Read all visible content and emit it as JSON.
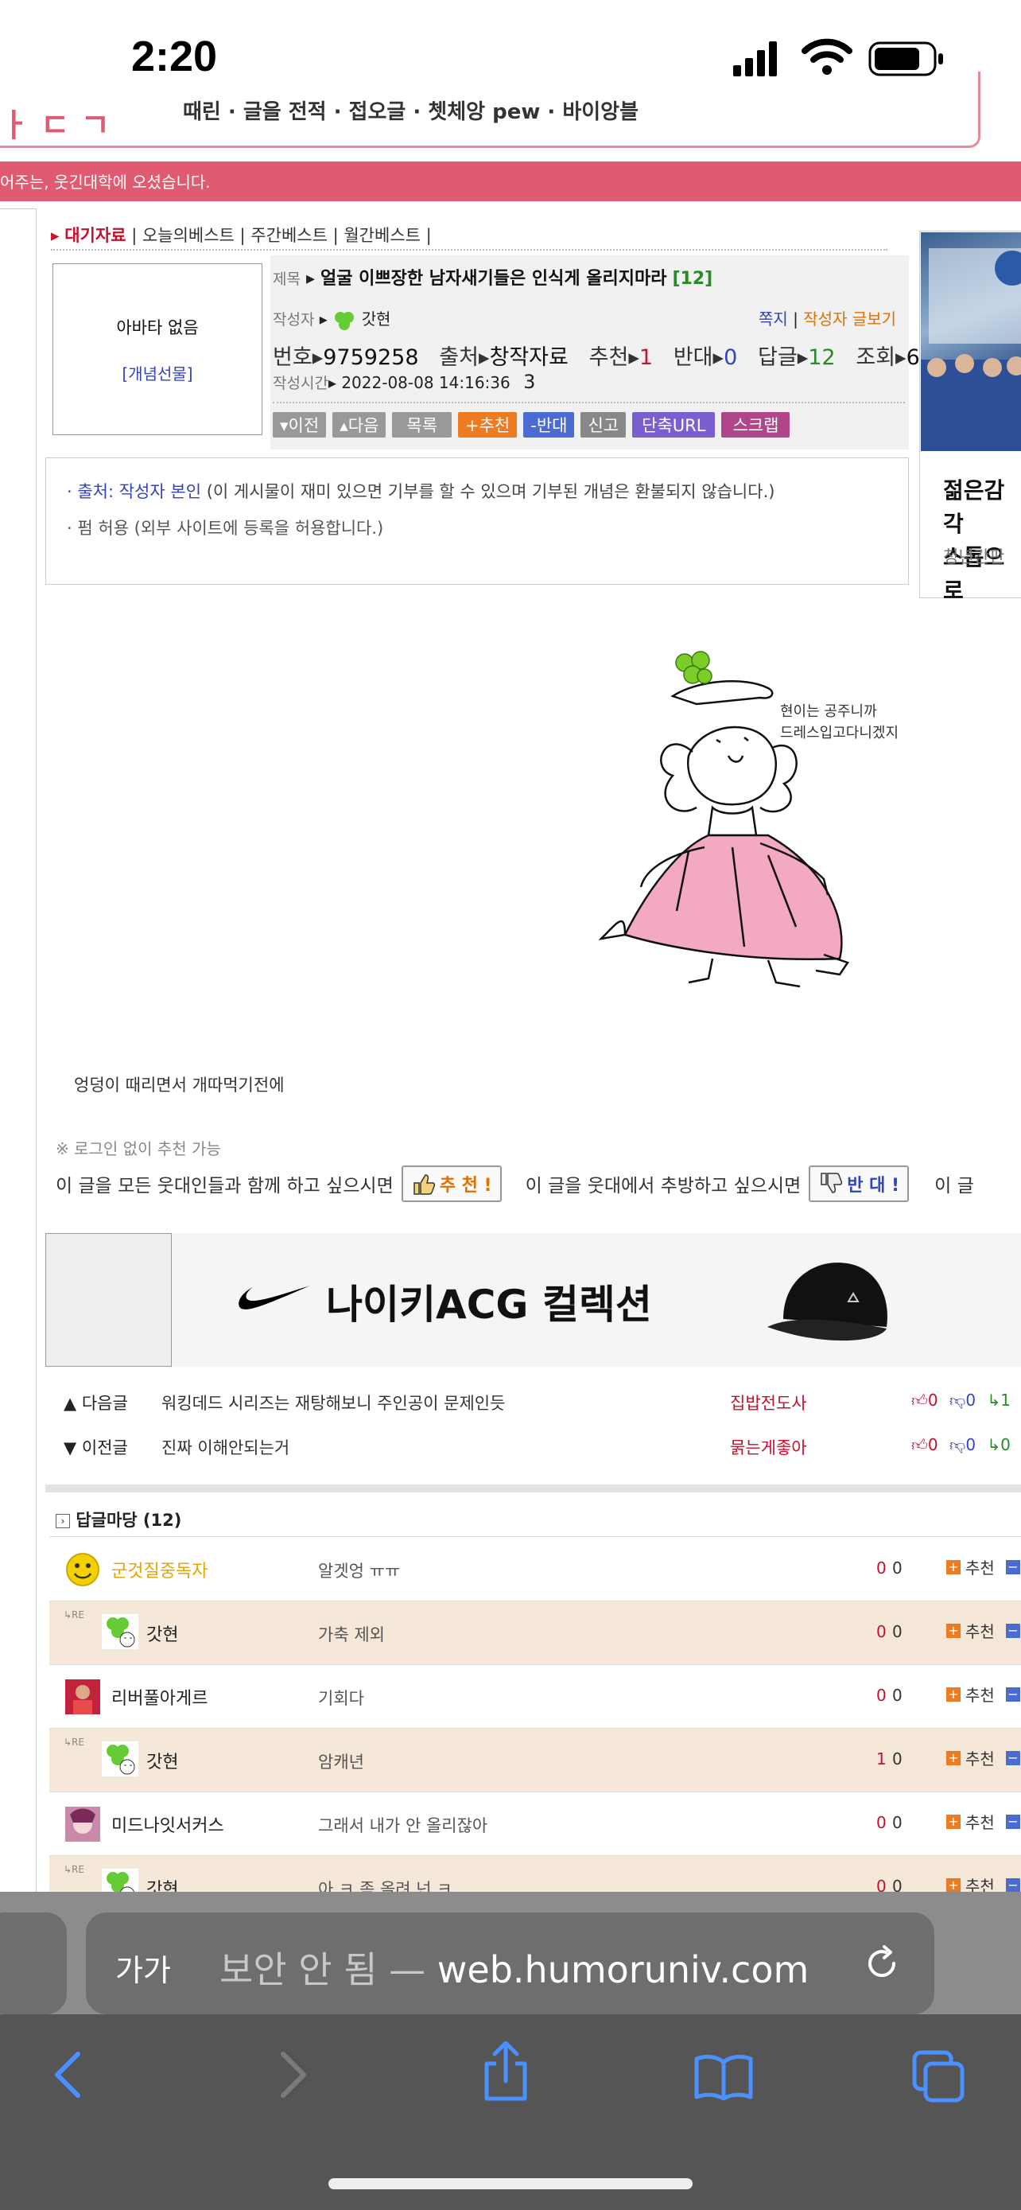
{
  "status_bar": {
    "time": "2:20"
  },
  "site": {
    "nav_text": "때린   ·   글을 전적   ·   접오글   ·   쳇체앙 pew   ·   바이앙블",
    "welcome": "어주는, 웃긴대학에 오셨습니다."
  },
  "best_links": {
    "active": "대기자료",
    "items": [
      "오늘의베스트",
      "주간베스트",
      "월간베스트"
    ]
  },
  "post": {
    "avatar_text": "아바타 없음",
    "avatar_link": "[개념선물]",
    "title_label": "제목",
    "title": "얼굴 이쁘장한 남자새기들은 인식게 올리지마라",
    "title_count": "[12]",
    "author_label": "작성자",
    "author": "갓현",
    "msg_link": "쪽지",
    "author_posts_link": "작성자 글보기",
    "num_label": "번호",
    "num": "9759258",
    "source_label": "출처",
    "source": "창작자료",
    "rec_label": "추천",
    "rec": "1",
    "against_label": "반대",
    "against": "0",
    "reply_label": "답글",
    "reply": "12",
    "view_label": "조회",
    "view": "6",
    "time_label": "작성시간",
    "time": "2022-08-08 14:16:36",
    "time_extra": "3",
    "buttons": {
      "prev": "▾이전",
      "next": "▴다음",
      "list": "목록",
      "rec": "+추천",
      "against": "-반대",
      "report": "신고",
      "shorturl": "단축URL",
      "scrap": "스크랩"
    },
    "source_line_label": "· 출처: 작성자 본인",
    "source_line_rest": " (이 게시물이 재미 있으면 기부를 할 수 있으며 기부된 개념은 환불되지 않습니다.)",
    "share_line": "· 펌 허용 (외부 사이트에 등록을 허용합니다.)",
    "drawing_text1": "현이는 공주니까",
    "drawing_text2": "드레스입고다니겠지",
    "caption": "엉덩이 때리면서 개따먹기전에"
  },
  "side_card": {
    "title1": "젊은감각",
    "title2": "스톱으로",
    "sub": "청년간판"
  },
  "recommend": {
    "no_login": "※ 로그인 없이 추천 가능",
    "rec_prompt": "이 글을 모든 웃대인들과 함께 하고 싶으시면",
    "rec_btn": "추 천 !",
    "against_prompt": "이 글을 웃대에서 추방하고 싶으시면",
    "against_btn": "반 대 !",
    "tail": "이 글"
  },
  "ad": {
    "text": "나이키ACG 컬렉션"
  },
  "next_post": {
    "label": "▲ 다음글",
    "title": "워킹데드 시리즈는 재탕해보니 주인공이 문제인듯",
    "nick": "집밥전도사",
    "up": "0",
    "down": "0",
    "reply": "1"
  },
  "prev_post": {
    "label": "▼ 이전글",
    "title": "진짜 이해안되는거",
    "nick": "묽는게좋아",
    "up": "0",
    "down": "0",
    "reply": "0"
  },
  "comments": {
    "header": "답글마당 (12)",
    "rec_label": "추천",
    "rows": [
      {
        "nick": "군것질중독자",
        "text": "알겟엉 ㅠㅠ",
        "up": "0",
        "down": "0"
      },
      {
        "nick": "갓현",
        "text": "가축 제외",
        "up": "0",
        "down": "0"
      },
      {
        "nick": "리버풀아게르",
        "text": "기회다",
        "up": "0",
        "down": "0"
      },
      {
        "nick": "갓현",
        "text": "암캐년",
        "up": "1",
        "down": "0"
      },
      {
        "nick": "미드나잇서커스",
        "text": "그래서 내가 안 올리잖아",
        "up": "0",
        "down": "0"
      },
      {
        "nick": "갓현",
        "text": "아 ㅋ 좀 올려 넌 ㅋ",
        "up": "0",
        "down": "0"
      }
    ]
  },
  "safari": {
    "aa": "가가",
    "insecure": "보안 안 됨 — ",
    "domain": "web.humoruniv.com"
  },
  "colors": {
    "accent": "#e05a72",
    "link": "#3344bb",
    "red": "#c8102e",
    "safari_bg": "#555555"
  }
}
